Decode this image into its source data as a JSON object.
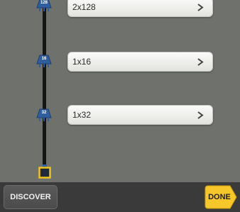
{
  "splitters": [
    {
      "ratio": "128",
      "label": "2x128"
    },
    {
      "ratio": "16",
      "label": "1x16"
    },
    {
      "ratio": "32",
      "label": "1x32"
    }
  ],
  "toolbar": {
    "discover_label": "DISCOVER",
    "done_label": "DONE"
  },
  "colors": {
    "background": "#6e716c",
    "splitter_blue": "#2f5e9e",
    "olt_yellow": "#f0c419",
    "done_yellow": "#f6c72a",
    "bottom_bar": "#3a3a3a"
  },
  "icons": {
    "splitter": "splitter-icon",
    "chevron": "chevron-right-icon",
    "olt": "olt-port-icon"
  }
}
